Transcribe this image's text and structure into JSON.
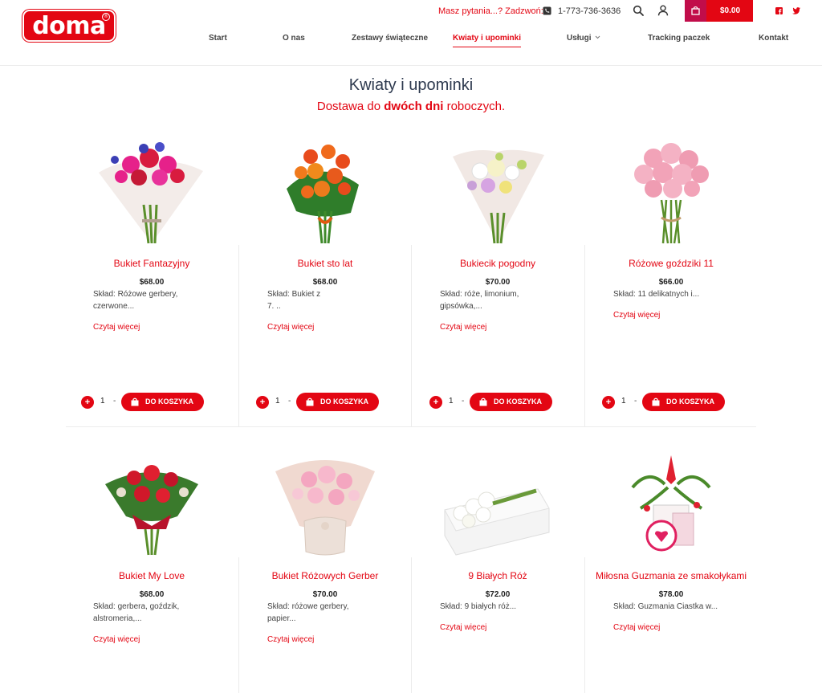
{
  "brand": {
    "logo_text": "doma",
    "logo_mark": "®",
    "color": "#e30613"
  },
  "topbar": {
    "contact_question": "Masz pytania...? Zadzwoń:",
    "phone": "1-773-736-3636",
    "cart_total": "$0.00",
    "icons": [
      "phone-icon",
      "search-icon",
      "user-icon",
      "cart-icon",
      "facebook-icon",
      "twitter-icon"
    ]
  },
  "nav": {
    "items": [
      {
        "label": "Start"
      },
      {
        "label": "O nas"
      },
      {
        "label": "Zestawy świąteczne"
      },
      {
        "label": "Kwiaty i upominki"
      },
      {
        "label": "Usługi"
      },
      {
        "label": "Tracking paczek"
      },
      {
        "label": "Kontakt"
      }
    ],
    "active": "Kwiaty i upominki"
  },
  "page": {
    "title": "Kwiaty i upominki",
    "subtitle_prefix": "Dostawa do ",
    "subtitle_bold": "dwóch dni",
    "subtitle_suffix": " roboczych."
  },
  "products": [
    {
      "name": "Bukiet Fantazyjny",
      "price": "$68.00",
      "desc_line1": "Skład: Różowe gerbery,",
      "desc_line2": "czerwone...",
      "more": "Czytaj więcej",
      "qty": "1",
      "add_label": "DO KOSZYKA"
    },
    {
      "name": "Bukiet sto lat",
      "price": "$68.00",
      "desc_line1": "Skład: Bukiet z",
      "desc_line2": "7. ..",
      "more": "Czytaj więcej",
      "qty": "1",
      "add_label": "DO KOSZYKA"
    },
    {
      "name": "Bukiecik pogodny",
      "price": "$70.00",
      "desc_line1": "Skład: róże, limonium,",
      "desc_line2": "gipsówka,...",
      "more": "Czytaj więcej",
      "qty": "1",
      "add_label": "DO KOSZYKA"
    },
    {
      "name": "Różowe goździki 11",
      "price": "$66.00",
      "desc_line1": "Skład: 11 delikatnych i...",
      "desc_line2": "",
      "more": "Czytaj więcej",
      "qty": "1",
      "add_label": "DO KOSZYKA"
    },
    {
      "name": "Bukiet My Love",
      "price": "$68.00",
      "desc_line1": "Skład: gerbera, goździk,",
      "desc_line2": "alstromeria,...",
      "more": "Czytaj więcej"
    },
    {
      "name": "Bukiet Różowych Gerber",
      "price": "$70.00",
      "desc_line1": "Skład: różowe gerbery,",
      "desc_line2": "papier...",
      "more": "Czytaj więcej"
    },
    {
      "name": "9 Białych Róż",
      "price": "$72.00",
      "desc_line1": "Skład: 9 białych róż...",
      "desc_line2": "",
      "more": "Czytaj więcej"
    },
    {
      "name": "Miłosna Guzmania ze smakołykami",
      "price": "$78.00",
      "desc_line1": "Skład: Guzmania Ciastka w...",
      "desc_line2": "",
      "more": "Czytaj więcej"
    }
  ]
}
